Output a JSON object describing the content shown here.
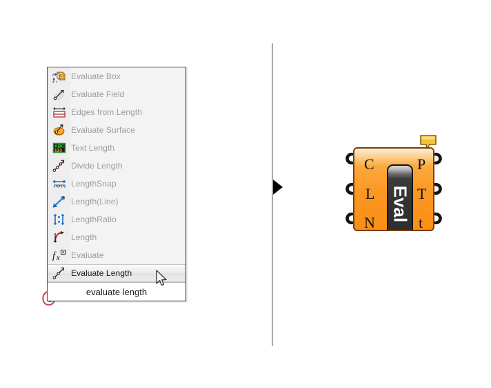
{
  "canvas": {
    "background_color": "#ffffff",
    "divider_color": "#a9a9a9",
    "marker_color": "#000000",
    "spiral_icon_color": "#c9475a"
  },
  "menu": {
    "footer_text": "evaluate length",
    "selected_index": 11,
    "item_text_color": "#9c9c9c",
    "selected_text_color": "#1a1a1a",
    "items": [
      {
        "label": "Evaluate Box",
        "icon": "evaluate-box-icon",
        "selected": false
      },
      {
        "label": "Evaluate Field",
        "icon": "evaluate-field-icon",
        "selected": false
      },
      {
        "label": "Edges from Length",
        "icon": "edges-from-length-icon",
        "selected": false
      },
      {
        "label": "Evaluate Surface",
        "icon": "evaluate-surface-icon",
        "selected": false
      },
      {
        "label": "Text Length",
        "icon": "text-length-icon",
        "selected": false
      },
      {
        "label": "Divide Length",
        "icon": "divide-length-icon",
        "selected": false
      },
      {
        "label": "LengthSnap",
        "icon": "length-snap-icon",
        "selected": false
      },
      {
        "label": "Length(Line)",
        "icon": "length-line-icon",
        "selected": false
      },
      {
        "label": "LengthRatio",
        "icon": "length-ratio-icon",
        "selected": false
      },
      {
        "label": "Length",
        "icon": "length-icon",
        "selected": false
      },
      {
        "label": "Evaluate",
        "icon": "evaluate-icon",
        "selected": false
      },
      {
        "label": "Evaluate Length",
        "icon": "evaluate-length-icon",
        "selected": true
      }
    ]
  },
  "component": {
    "name": "Eval",
    "body_color": "#fb9722",
    "center_color": "#333333",
    "border_color": "#7a3b10",
    "balloon_color": "#f0b429",
    "inputs": [
      {
        "label": "C"
      },
      {
        "label": "L"
      },
      {
        "label": "N"
      }
    ],
    "outputs": [
      {
        "label": "P"
      },
      {
        "label": "T"
      },
      {
        "label": "t"
      }
    ]
  }
}
